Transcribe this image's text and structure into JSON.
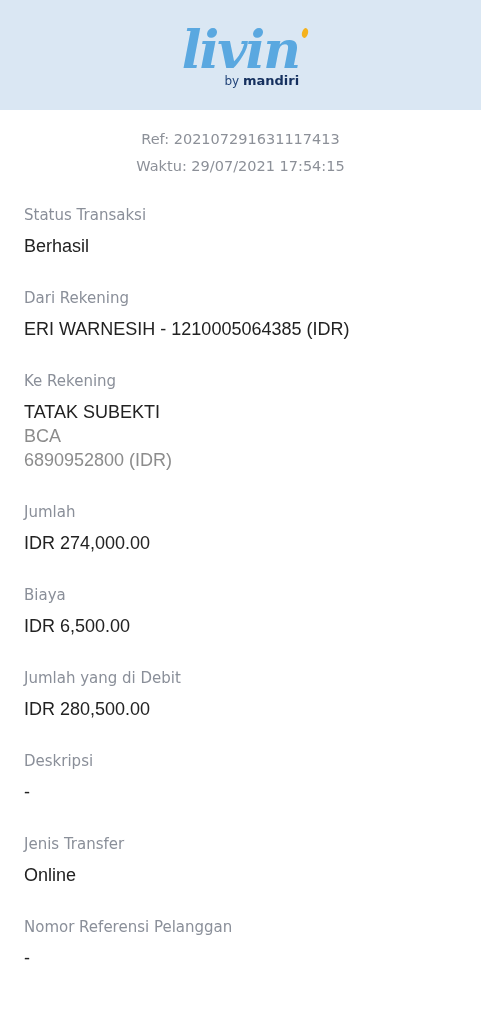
{
  "header": {
    "logo": {
      "wordmark": "livin",
      "byline_prefix": "by",
      "byline_brand": "mandiri"
    }
  },
  "receipt": {
    "ref": "Ref: 202107291631117413",
    "time": "Waktu: 29/07/2021 17:54:15"
  },
  "fields": [
    {
      "label": "Status Transaksi",
      "lines": [
        {
          "text": "Berhasil",
          "kind": "primary"
        }
      ]
    },
    {
      "label": "Dari Rekening",
      "lines": [
        {
          "text": "ERI WARNESIH - 1210005064385 (IDR)",
          "kind": "primary"
        }
      ]
    },
    {
      "label": "Ke Rekening",
      "lines": [
        {
          "text": "TATAK SUBEKTI",
          "kind": "primary"
        },
        {
          "text": "BCA",
          "kind": "secondary"
        },
        {
          "text": "6890952800 (IDR)",
          "kind": "secondary"
        }
      ]
    },
    {
      "label": "Jumlah",
      "lines": [
        {
          "text": "IDR 274,000.00",
          "kind": "primary"
        }
      ]
    },
    {
      "label": "Biaya",
      "lines": [
        {
          "text": "IDR 6,500.00",
          "kind": "primary"
        }
      ]
    },
    {
      "label": "Jumlah yang di Debit",
      "lines": [
        {
          "text": "IDR 280,500.00",
          "kind": "primary"
        }
      ]
    },
    {
      "label": "Deskripsi",
      "lines": [
        {
          "text": "-",
          "kind": "primary"
        }
      ]
    },
    {
      "label": "Jenis Transfer",
      "lines": [
        {
          "text": "Online",
          "kind": "primary"
        }
      ]
    },
    {
      "label": "Nomor Referensi Pelanggan",
      "lines": [
        {
          "text": "-",
          "kind": "primary"
        }
      ]
    }
  ]
}
